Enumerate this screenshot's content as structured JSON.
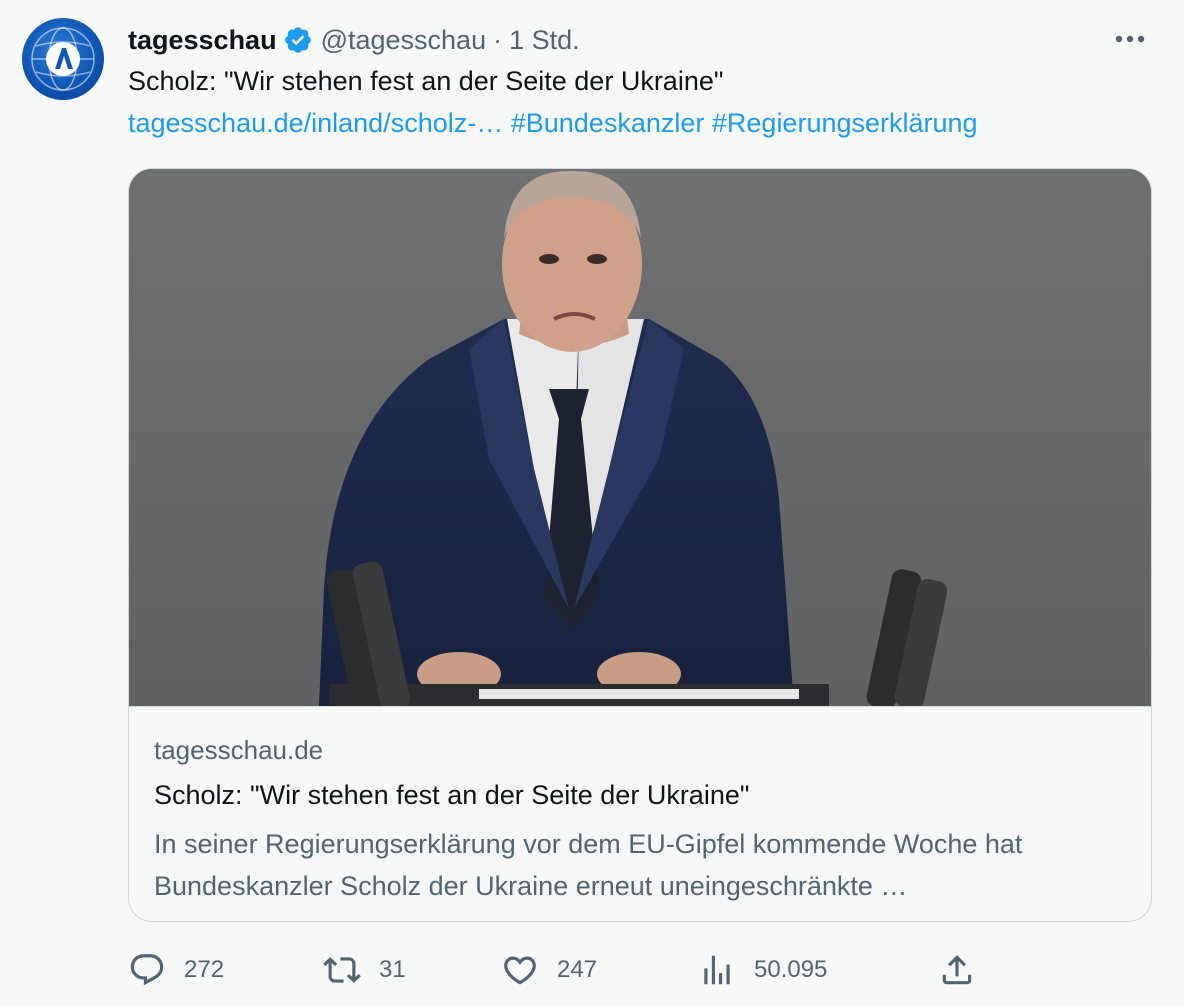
{
  "author": {
    "name": "tagesschau",
    "handle": "@tagesschau",
    "separator": "·",
    "time": "1 Std."
  },
  "tweet": {
    "text": "Scholz: \"Wir stehen fest an der Seite der Ukraine\"",
    "link": "tagesschau.de/inland/scholz-…",
    "hashtags": [
      "#Bundeskanzler",
      "#Regierungserklärung"
    ]
  },
  "card": {
    "domain": "tagesschau.de",
    "title": "Scholz: \"Wir stehen fest an der Seite der Ukraine\"",
    "description": "In seiner Regierungserklärung vor dem EU-Gipfel kommende Woche hat Bundeskanzler Scholz der Ukraine erneut uneingeschränkte …"
  },
  "actions": {
    "replies": "272",
    "retweets": "31",
    "likes": "247",
    "views": "50.095"
  },
  "icons": {
    "verified": "verified-badge-icon",
    "more": "more-icon",
    "reply": "reply-icon",
    "retweet": "retweet-icon",
    "like": "like-icon",
    "views": "views-icon",
    "share": "share-icon"
  },
  "colors": {
    "accent": "#1d9bf0",
    "text": "#0f1419",
    "secondary": "#536471",
    "border": "#cfd9de",
    "background": "#f7f8f8"
  }
}
